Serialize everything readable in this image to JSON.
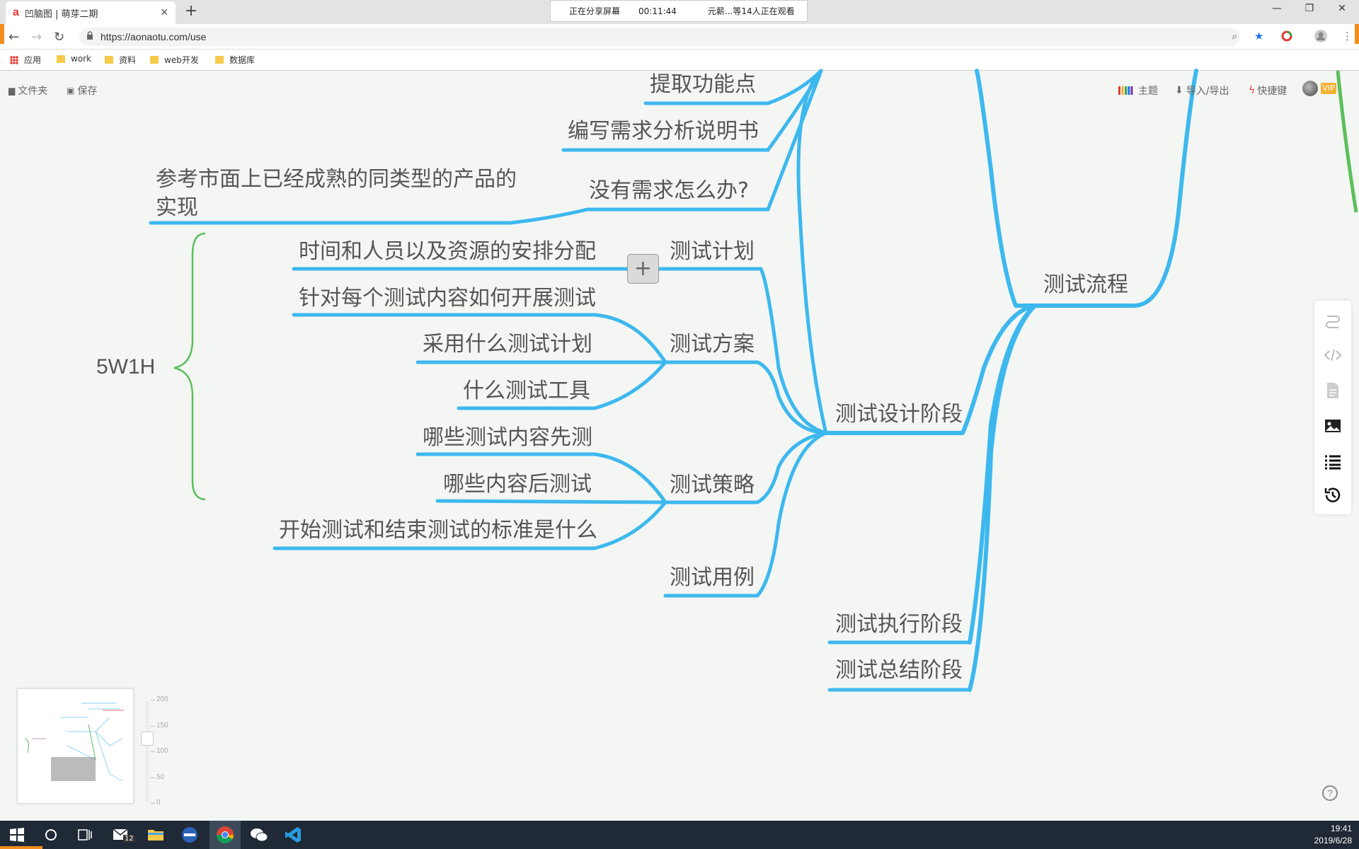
{
  "browser": {
    "tab_title": "凹脑图 | 萌芽二期",
    "tab_favicon": "a",
    "url": "https://aonaotu.com/use",
    "share_banner": {
      "status": "正在分享屏幕",
      "time": "00:11:44",
      "viewers": "元薪...等14人正在观看"
    },
    "bookmarks": [
      "应用",
      "work",
      "资料",
      "web开发",
      "数据库"
    ]
  },
  "app": {
    "toolbar_left": [
      "文件夹",
      "保存"
    ],
    "toolbar_right": [
      "主题",
      "导入/导出",
      "快捷键"
    ],
    "vip_badge": "VIP"
  },
  "mindmap": {
    "root_right": "测试流程",
    "branch_design": "测试设计阶段",
    "branch_execute": "测试执行阶段",
    "branch_summary": "测试总结阶段",
    "top_items": [
      "提取功能点",
      "编写需求分析说明书",
      "没有需求怎么办?"
    ],
    "no_requirement_answer": "参考市面上已经成熟的同类型的产品的实现",
    "test_plan": "测试计划",
    "test_plan_child": "时间和人员以及资源的安排分配",
    "test_scheme": "测试方案",
    "test_scheme_children": [
      "针对每个测试内容如何开展测试",
      "采用什么测试计划",
      "什么测试工具"
    ],
    "test_strategy": "测试策略",
    "test_strategy_children": [
      "哪些测试内容先测",
      "哪些内容后测试",
      "开始测试和结束测试的标准是什么"
    ],
    "test_case": "测试用例",
    "summary_label": "5W1H",
    "add_button": "+",
    "branch_color": "#3db8ee",
    "summary_color": "#5cbf5c"
  },
  "side_panel_icons": [
    "relation-icon",
    "code-icon",
    "note-icon",
    "image-icon",
    "list-icon",
    "history-icon"
  ],
  "zoom": {
    "ticks": [
      "200",
      "150",
      "100",
      "50",
      "0"
    ],
    "level": 125
  },
  "taskbar": {
    "time": "19:41",
    "date": "2019/6/28",
    "mail_badge": "12"
  }
}
